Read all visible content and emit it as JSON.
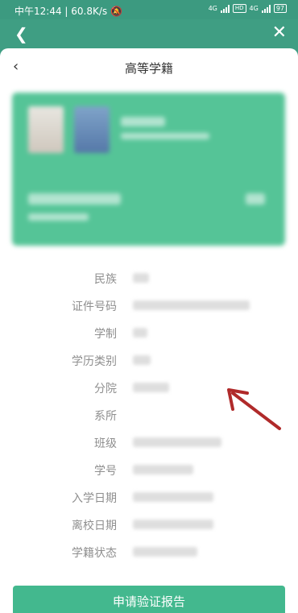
{
  "status_bar": {
    "time": "中午12:44",
    "speed": "60.8K/s",
    "network_1": "4G",
    "hd": "HD",
    "network_2": "4G",
    "battery": "97"
  },
  "web_bar": {
    "back_icon": "chevron-left-icon",
    "close_icon": "close-icon"
  },
  "nav": {
    "title": "高等学籍"
  },
  "fields": [
    {
      "label": "民族"
    },
    {
      "label": "证件号码"
    },
    {
      "label": "学制"
    },
    {
      "label": "学历类别"
    },
    {
      "label": "分院"
    },
    {
      "label": "系所"
    },
    {
      "label": "班级"
    },
    {
      "label": "学号"
    },
    {
      "label": "入学日期"
    },
    {
      "label": "离校日期"
    },
    {
      "label": "学籍状态"
    }
  ],
  "apply_button": {
    "label": "申请验证报告"
  },
  "colors": {
    "header": "#3f9e83",
    "card": "#55c497",
    "button": "#43b88e",
    "annotation_arrow": "#b02a2a"
  }
}
